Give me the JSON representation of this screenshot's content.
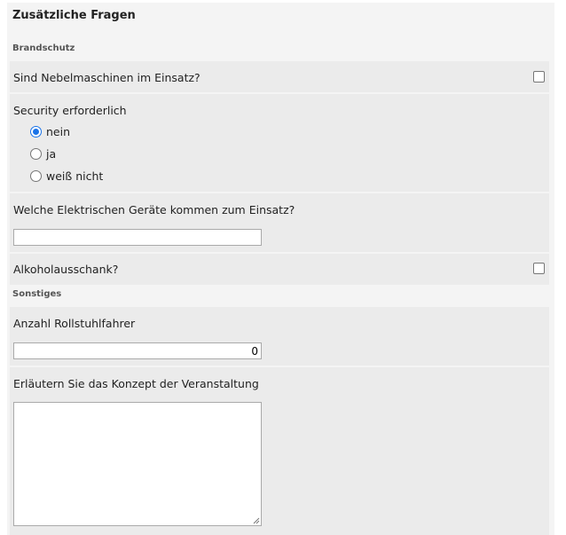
{
  "title": "Zusätzliche Fragen",
  "sections": {
    "brandschutz": "Brandschutz",
    "sonstiges": "Sonstiges"
  },
  "questions": {
    "nebelmaschinen": {
      "label": "Sind Nebelmaschinen im Einsatz?",
      "checked": false
    },
    "security": {
      "label": "Security erforderlich",
      "options": [
        "nein",
        "ja",
        "weiß nicht"
      ],
      "selected": "nein"
    },
    "elektrische_geraete": {
      "label": "Welche Elektrischen Geräte kommen zum Einsatz?",
      "value": ""
    },
    "alkoholausschank": {
      "label": "Alkoholausschank?",
      "checked": false
    },
    "rollstuhlfahrer": {
      "label": "Anzahl Rollstuhlfahrer",
      "value": "0"
    },
    "konzept": {
      "label": "Erläutern Sie das Konzept der Veranstaltung",
      "value": ""
    }
  },
  "colors": {
    "radio_selected": "#1a73e8",
    "panel_bg": "#f4f4f4",
    "row_bg": "#ebebeb"
  }
}
